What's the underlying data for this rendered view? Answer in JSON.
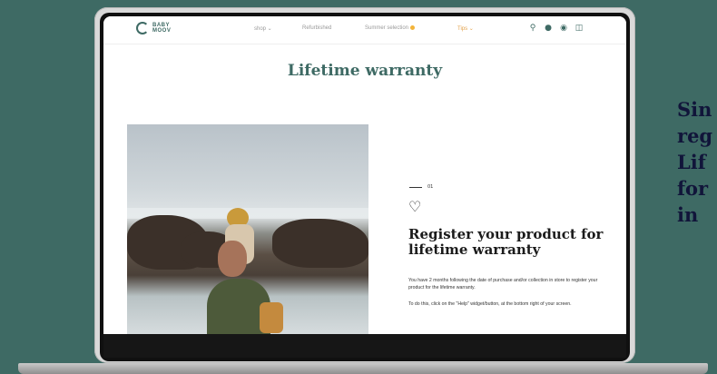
{
  "site": {
    "logo_text": "BABY MOOV",
    "nav": [
      {
        "label": "shop ⌄"
      },
      {
        "label": "Refurbished"
      },
      {
        "label": "Summer selection"
      },
      {
        "label": "Tips ⌄"
      }
    ],
    "page_title": "Lifetime warranty"
  },
  "content": {
    "step_number": "01",
    "headline": "Register your product for lifetime warranty",
    "paragraph_1": "You have 2 months following the date of purchase and/or collection in store to register your product for the lifetime warranty.",
    "paragraph_2": "To do this, click on the \"Help\" widget/button, at the bottom right of your screen."
  },
  "side_text": [
    "Sin",
    "reg",
    "Lif",
    "for",
    "in"
  ],
  "icons": [
    "search-icon",
    "account-icon",
    "location-pin-icon",
    "cart-icon",
    "heart-icon"
  ],
  "colors": {
    "background": "#3e6a64",
    "brand_green": "#3e6a64",
    "tips_orange": "#e3a24a",
    "side_text": "#11153a"
  }
}
